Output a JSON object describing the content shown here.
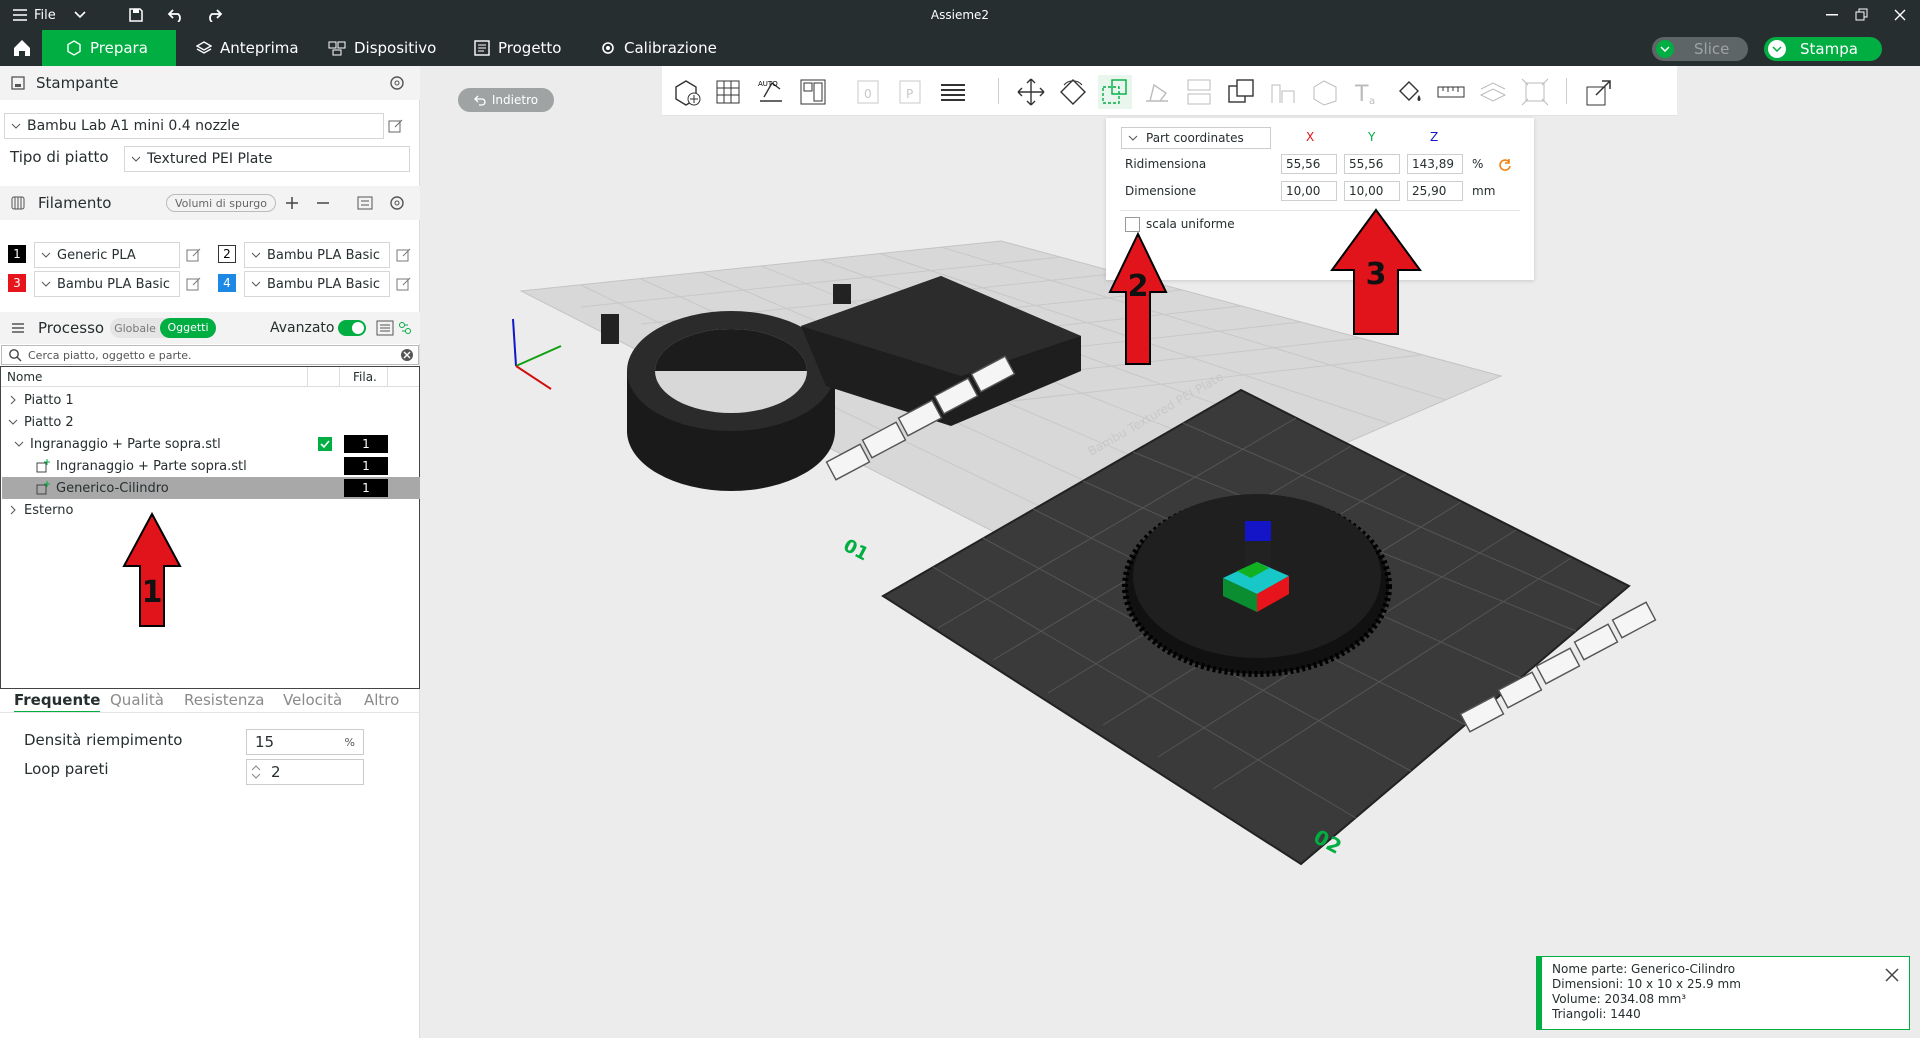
{
  "window": {
    "title": "Assieme2",
    "file_menu": "File"
  },
  "tabs": [
    {
      "label": "Prepara",
      "icon": "cube-icon"
    },
    {
      "label": "Anteprima",
      "icon": "layers-icon"
    },
    {
      "label": "Dispositivo",
      "icon": "device-icon"
    },
    {
      "label": "Progetto",
      "icon": "project-icon"
    },
    {
      "label": "Calibrazione",
      "icon": "calibration-icon"
    }
  ],
  "actions": {
    "slice": "Slice",
    "print": "Stampa"
  },
  "back_button": "Indietro",
  "printer": {
    "section": "Stampante",
    "model": "Bambu Lab A1 mini 0.4 nozzle",
    "plate_label": "Tipo di piatto",
    "plate_value": "Textured PEI Plate"
  },
  "filament": {
    "section": "Filamento",
    "purge_button": "Volumi di spurgo",
    "items": [
      {
        "num": "1",
        "name": "Generic PLA",
        "color": "#000000"
      },
      {
        "num": "2",
        "name": "Bambu PLA Basic",
        "color": "#ffffff"
      },
      {
        "num": "3",
        "name": "Bambu PLA Basic",
        "color": "#e8141c"
      },
      {
        "num": "4",
        "name": "Bambu PLA Basic",
        "color": "#1e88e5"
      }
    ]
  },
  "process": {
    "section": "Processo",
    "toggle_global": "Globale",
    "toggle_objects": "Oggetti",
    "advanced": "Avanzato",
    "search_placeholder": "Cerca piatto, oggetto e parte.",
    "col_name": "Nome",
    "col_fila": "Fila.",
    "tree": [
      {
        "label": "Piatto 1",
        "fila": ""
      },
      {
        "label": "Piatto 2",
        "fila": ""
      },
      {
        "label": "Ingranaggio + Parte sopra.stl",
        "fila": "1"
      },
      {
        "label": "Ingranaggio + Parte sopra.stl",
        "fila": "1"
      },
      {
        "label": "Generico-Cilindro",
        "fila": "1"
      },
      {
        "label": "Esterno",
        "fila": ""
      }
    ],
    "subtabs": [
      "Frequente",
      "Qualità",
      "Resistenza",
      "Velocità",
      "Altro"
    ],
    "infill_label": "Densità riempimento",
    "infill_value": "15",
    "infill_unit": "%",
    "walls_label": "Loop pareti",
    "walls_value": "2"
  },
  "scale_panel": {
    "coord_mode": "Part coordinates",
    "axis_x": "X",
    "axis_y": "Y",
    "axis_z": "Z",
    "resize_label": "Ridimensiona",
    "resize_x": "55,56",
    "resize_y": "55,56",
    "resize_z": "143,89",
    "resize_unit": "%",
    "dim_label": "Dimensione",
    "dim_x": "10,00",
    "dim_y": "10,00",
    "dim_z": "25,90",
    "dim_unit": "mm",
    "uniform_label": "scala uniforme"
  },
  "viewport": {
    "plate1_number": "01",
    "plate2_number": "02",
    "plate2_label": "Bambu Textured PEI Plate"
  },
  "annotations": [
    "1",
    "2",
    "3"
  ],
  "notification": {
    "name": "Nome parte: Generico-Cilindro",
    "dims": "Dimensioni: 10 x 10 x 25.9 mm",
    "volume": "Volume: 2034.08 mm³",
    "triangles": "Triangoli: 1440"
  },
  "colors": {
    "accent": "#00ae42",
    "dark": "#262e30",
    "arrow": "#e0141a"
  }
}
